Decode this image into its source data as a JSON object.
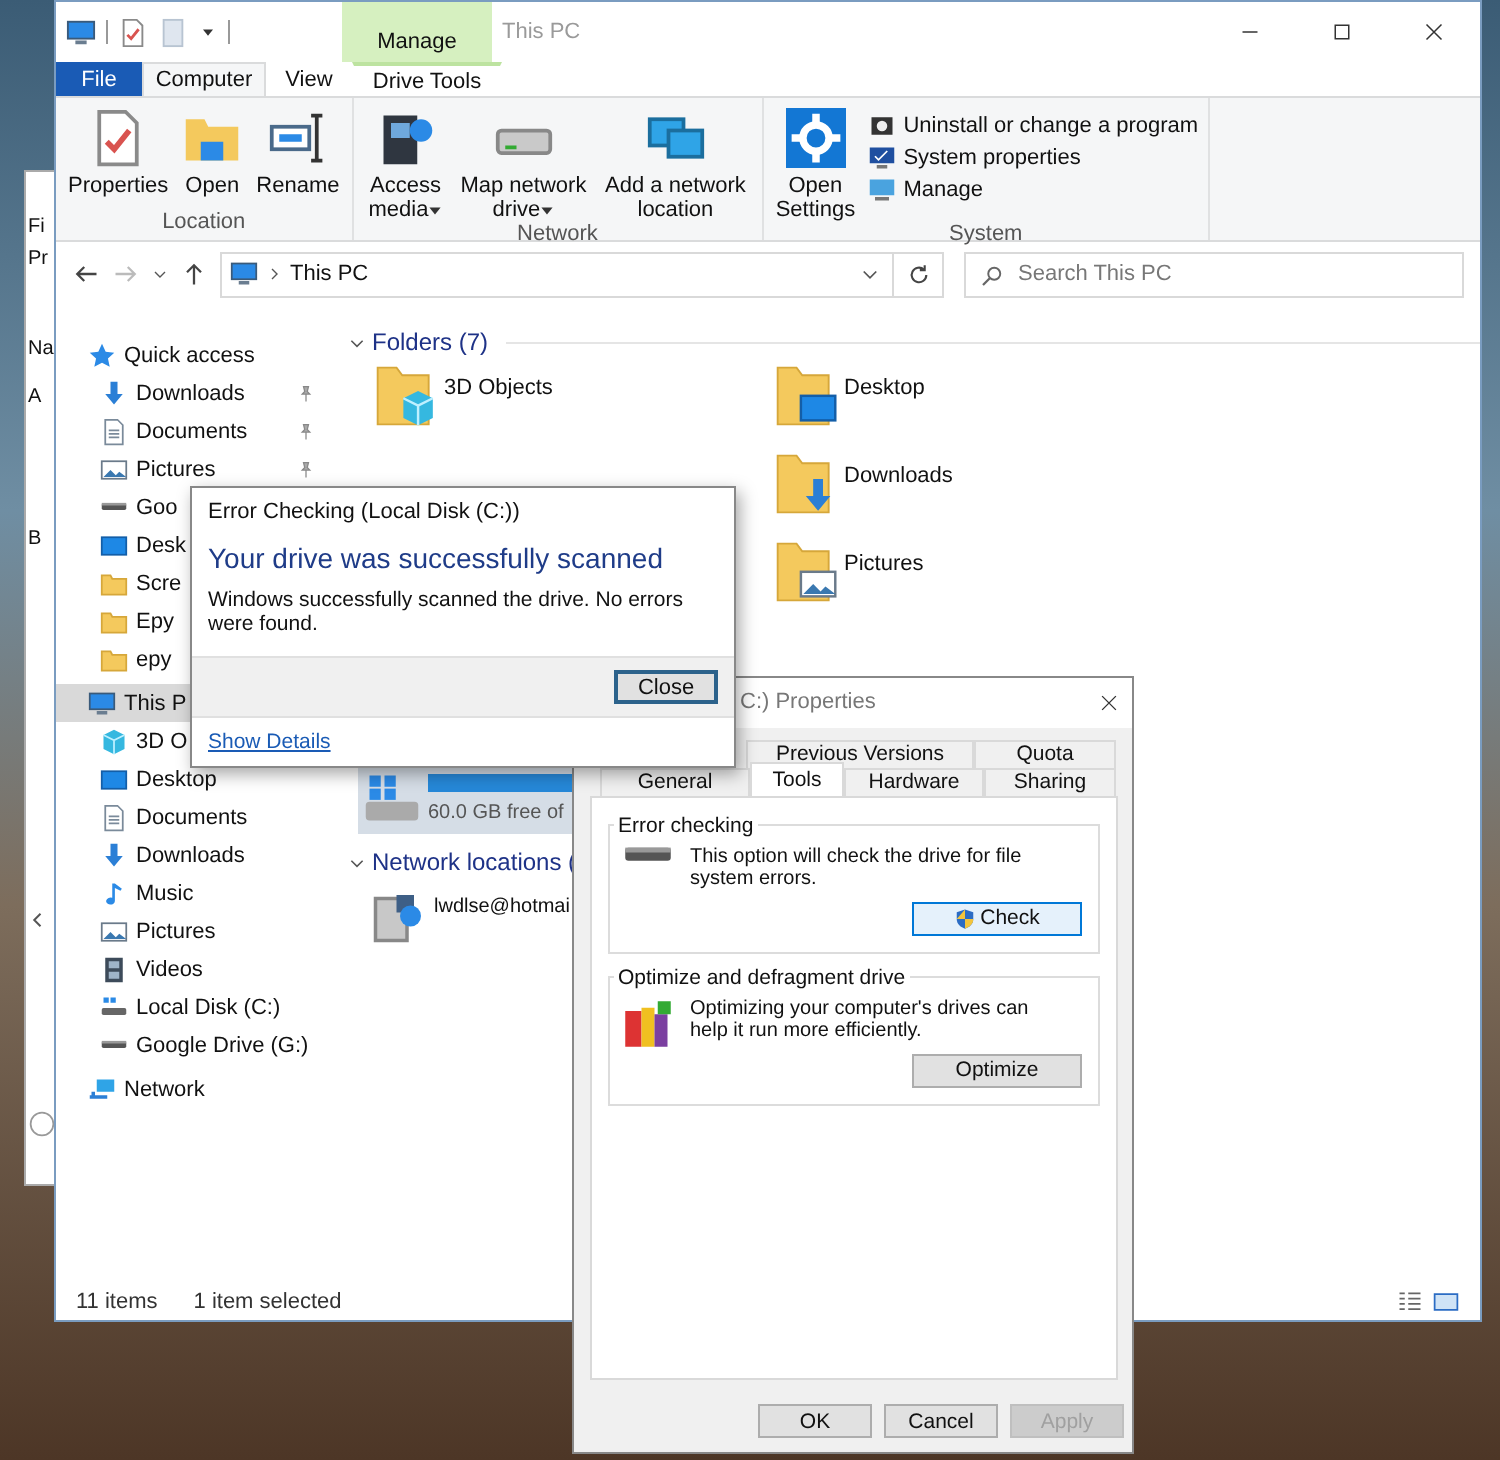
{
  "background_window": {
    "labels": [
      "Fi",
      "Pr",
      "Na",
      "A",
      "B"
    ]
  },
  "explorer": {
    "title": "This PC",
    "context_tab": "Manage",
    "ribbon_tabs": [
      {
        "label": "File",
        "kind": "file",
        "selected": false
      },
      {
        "label": "Computer",
        "kind": "tab",
        "selected": true
      },
      {
        "label": "View",
        "kind": "tab",
        "selected": false
      },
      {
        "label": "Drive Tools",
        "kind": "context",
        "selected": false
      }
    ],
    "ribbon_groups": [
      {
        "label": "Location",
        "commands": [
          {
            "label": "Properties",
            "kind": "properties",
            "dropdown": false
          },
          {
            "label": "Open",
            "kind": "open",
            "dropdown": false
          },
          {
            "label": "Rename",
            "kind": "rename",
            "dropdown": false
          }
        ]
      },
      {
        "label": "Network",
        "commands": [
          {
            "label": "Access media",
            "kind": "media",
            "dropdown": true
          },
          {
            "label": "Map network drive",
            "kind": "map-drive",
            "dropdown": true
          },
          {
            "label": "Add a network location",
            "kind": "add-location",
            "dropdown": false
          }
        ]
      },
      {
        "label": "System",
        "commands": [
          {
            "label": "Open Settings",
            "kind": "settings",
            "dropdown": false
          }
        ],
        "small_commands": [
          {
            "label": "Uninstall or change a program",
            "kind": "uninstall"
          },
          {
            "label": "System properties",
            "kind": "system"
          },
          {
            "label": "Manage",
            "kind": "manage"
          }
        ]
      }
    ],
    "address": "This PC",
    "search": {
      "placeholder": "Search This PC"
    },
    "nav": [
      {
        "label": "Quick access",
        "kind": "quick-access",
        "selected": false,
        "children": [
          {
            "label": "Downloads",
            "kind": "downloads",
            "pinned": true,
            "selected": false
          },
          {
            "label": "Documents",
            "kind": "documents",
            "pinned": true,
            "selected": false
          },
          {
            "label": "Pictures",
            "kind": "pictures",
            "pinned": true,
            "selected": false
          },
          {
            "label": "Goo",
            "kind": "drive",
            "pinned": false,
            "selected": false
          },
          {
            "label": "Desk",
            "kind": "desktop",
            "pinned": false,
            "selected": false
          },
          {
            "label": "Scre",
            "kind": "folder",
            "pinned": false,
            "selected": false
          },
          {
            "label": "Epy",
            "kind": "folder",
            "pinned": false,
            "selected": false
          },
          {
            "label": "epy",
            "kind": "folder",
            "pinned": false,
            "selected": false
          }
        ]
      },
      {
        "label": "This P",
        "kind": "pc",
        "selected": true,
        "children": [
          {
            "label": "3D O",
            "kind": "cube",
            "selected": false
          },
          {
            "label": "Desktop",
            "kind": "desktop",
            "selected": false
          },
          {
            "label": "Documents",
            "kind": "documents",
            "selected": false
          },
          {
            "label": "Downloads",
            "kind": "downloads",
            "selected": false
          },
          {
            "label": "Music",
            "kind": "music",
            "selected": false
          },
          {
            "label": "Pictures",
            "kind": "pictures",
            "selected": false
          },
          {
            "label": "Videos",
            "kind": "videos",
            "selected": false
          },
          {
            "label": "Local Disk (C:)",
            "kind": "local-disk",
            "selected": false
          },
          {
            "label": "Google Drive (G:)",
            "kind": "drive",
            "selected": false
          }
        ]
      },
      {
        "label": "Network",
        "kind": "network",
        "selected": false
      }
    ],
    "folders": {
      "header": "Folders (7)",
      "left": [
        {
          "name": "3D Objects",
          "kind": "cube"
        }
      ],
      "right": [
        {
          "name": "Desktop",
          "kind": "desktop"
        },
        {
          "name": "Downloads",
          "kind": "downloads"
        },
        {
          "name": "Pictures",
          "kind": "pictures"
        }
      ]
    },
    "drive": {
      "caption": "60.0 GB free of",
      "selected": true
    },
    "network": {
      "header": "Network locations (",
      "items": [
        {
          "name": "lwdlse@hotmai"
        }
      ]
    },
    "status": {
      "count": "11 items",
      "selection": "1 item selected"
    }
  },
  "properties_dialog": {
    "title": "C:) Properties",
    "tab_rows": [
      [
        {
          "label": "Previous Versions",
          "selected": false
        },
        {
          "label": "Quota",
          "selected": false
        }
      ],
      [
        {
          "label": "General",
          "selected": false
        },
        {
          "label": "Tools",
          "selected": true
        },
        {
          "label": "Hardware",
          "selected": false
        },
        {
          "label": "Sharing",
          "selected": false
        }
      ]
    ],
    "sections": [
      {
        "title": "Error checking",
        "kind": "check",
        "text": "This option will check the drive for file system errors.",
        "button": "Check",
        "shield": true,
        "focused": true
      },
      {
        "title": "Optimize and defragment drive",
        "kind": "optimize",
        "text": "Optimizing your computer's drives can help it run more efficiently.",
        "button": "Optimize",
        "shield": false,
        "focused": false
      }
    ],
    "buttons": [
      {
        "label": "OK",
        "disabled": false
      },
      {
        "label": "Cancel",
        "disabled": false
      },
      {
        "label": "Apply",
        "disabled": true
      }
    ]
  },
  "error_dialog": {
    "title": "Error Checking (Local Disk (C:))",
    "heading": "Your drive was successfully scanned",
    "message": "Windows successfully scanned the drive. No errors were found.",
    "button": "Close",
    "link": "Show Details"
  }
}
